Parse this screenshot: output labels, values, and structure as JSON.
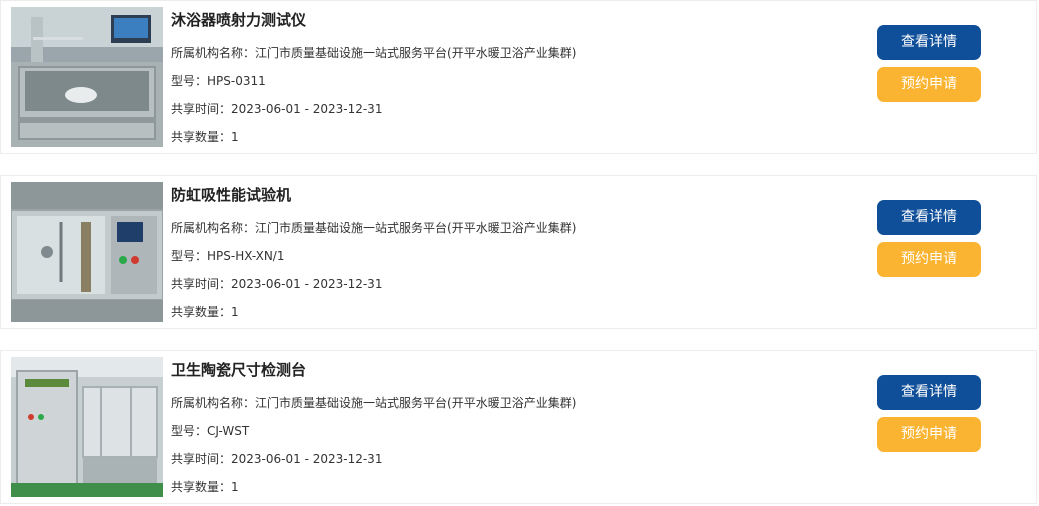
{
  "labels": {
    "org_prefix": "所属机构名称：",
    "model_prefix": "型号：",
    "time_prefix": "共享时间：",
    "count_prefix": "共享数量："
  },
  "buttons": {
    "detail_label": "查看详情",
    "apply_label": "预约申请"
  },
  "colors": {
    "detail_button": "#0f4f99",
    "apply_button": "#fbb431"
  },
  "items": [
    {
      "title": "沐浴器喷射力测试仪",
      "org": "江门市质量基础设施一站式服务平台(开平水暖卫浴产业集群)",
      "model": "HPS-0311",
      "share_time": "2023-06-01 - 2023-12-31",
      "count": "1"
    },
    {
      "title": "防虹吸性能试验机",
      "org": "江门市质量基础设施一站式服务平台(开平水暖卫浴产业集群)",
      "model": "HPS-HX-XN/1",
      "share_time": "2023-06-01 - 2023-12-31",
      "count": "1"
    },
    {
      "title": "卫生陶瓷尺寸检测台",
      "org": "江门市质量基础设施一站式服务平台(开平水暖卫浴产业集群)",
      "model": "CJ-WST",
      "share_time": "2023-06-01 - 2023-12-31",
      "count": "1"
    }
  ]
}
